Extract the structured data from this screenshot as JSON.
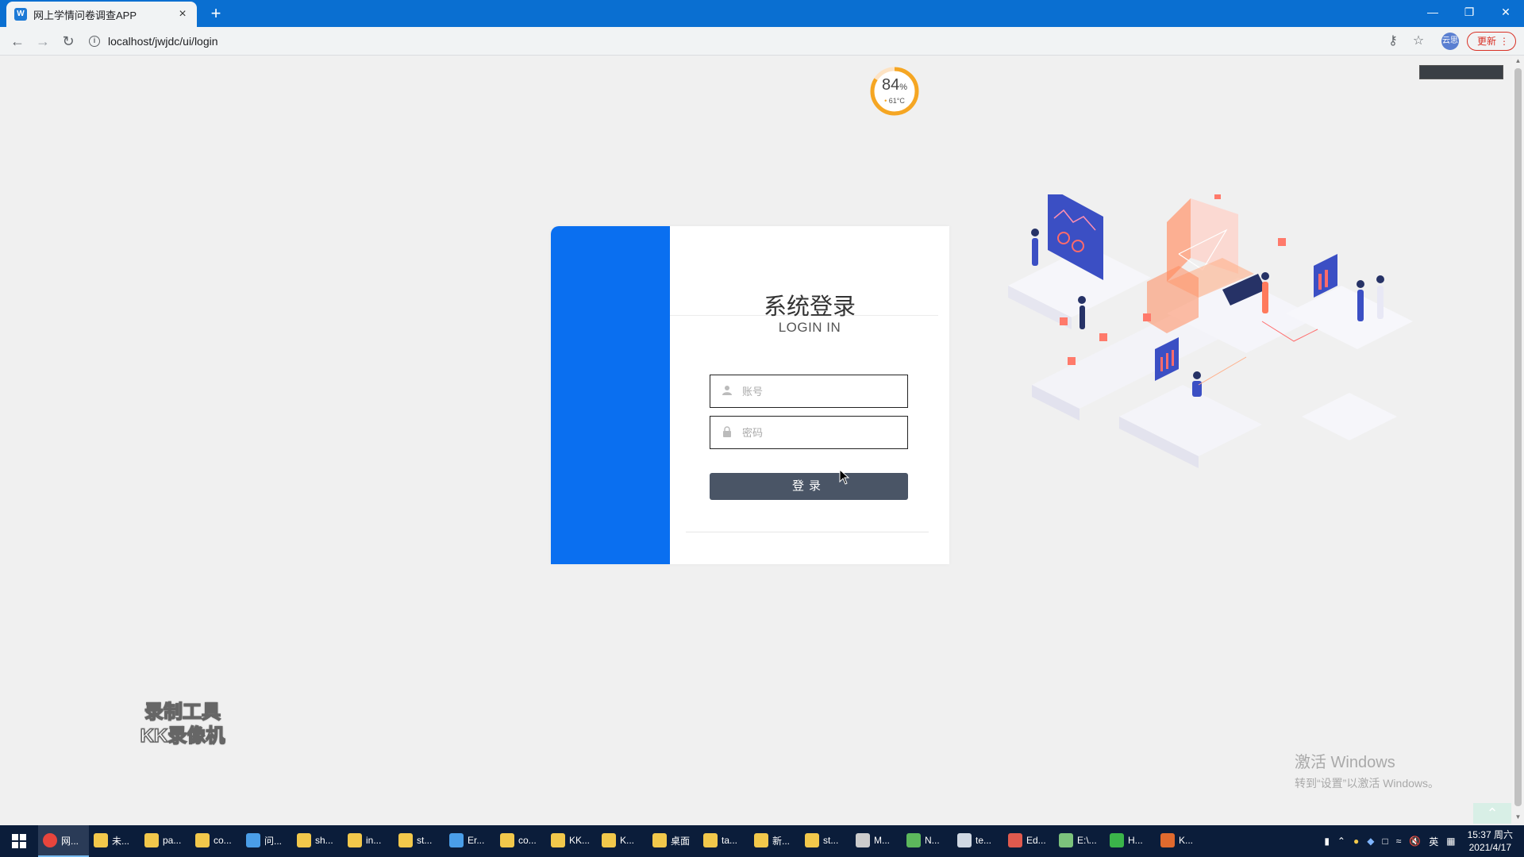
{
  "browser": {
    "tab_title": "网上学情问卷调查APP",
    "tab_close": "×",
    "new_tab": "+",
    "url": "localhost/jwjdc/ui/login",
    "update_label": "更新",
    "profile_label": "云思"
  },
  "widget": {
    "percent": "84",
    "percent_sign": "%",
    "temperature": "61°C",
    "percent_value": 0.84
  },
  "login": {
    "title_cn": "系统登录",
    "title_en": "LOGIN IN",
    "username_placeholder": "账号",
    "password_placeholder": "密码",
    "login_button": "登录"
  },
  "watermarks": {
    "recorder_line1": "录制工具",
    "recorder_line2": "KK录像机",
    "activate_line1": "激活 Windows",
    "activate_line2": "转到“设置”以激活 Windows。"
  },
  "taskbar": {
    "items": [
      {
        "label": "网...",
        "icon": "chrome-icon",
        "color": "#e8453c",
        "active": true
      },
      {
        "label": "未...",
        "icon": "folder-icon",
        "color": "#f2c84b"
      },
      {
        "label": "pa...",
        "icon": "folder-icon",
        "color": "#f2c84b"
      },
      {
        "label": "co...",
        "icon": "folder-icon",
        "color": "#f2c84b"
      },
      {
        "label": "问...",
        "icon": "app-icon",
        "color": "#4a9ee8"
      },
      {
        "label": "sh...",
        "icon": "folder-icon",
        "color": "#f2c84b"
      },
      {
        "label": "in...",
        "icon": "folder-icon",
        "color": "#f2c84b"
      },
      {
        "label": "st...",
        "icon": "folder-icon",
        "color": "#f2c84b"
      },
      {
        "label": "Er...",
        "icon": "app-icon",
        "color": "#4a9ee8"
      },
      {
        "label": "co...",
        "icon": "folder-icon",
        "color": "#f2c84b"
      },
      {
        "label": "KK...",
        "icon": "folder-icon",
        "color": "#f2c84b"
      },
      {
        "label": "K...",
        "icon": "folder-icon",
        "color": "#f2c84b"
      },
      {
        "label": "桌面",
        "icon": "folder-icon",
        "color": "#f2c84b"
      },
      {
        "label": "ta...",
        "icon": "folder-icon",
        "color": "#f2c84b"
      },
      {
        "label": "新...",
        "icon": "folder-icon",
        "color": "#f2c84b"
      },
      {
        "label": "st...",
        "icon": "folder-icon",
        "color": "#f2c84b"
      },
      {
        "label": "M...",
        "icon": "pen-icon",
        "color": "#cccccc"
      },
      {
        "label": "N...",
        "icon": "app-icon",
        "color": "#5cb85c"
      },
      {
        "label": "te...",
        "icon": "app-icon",
        "color": "#cfd8e3"
      },
      {
        "label": "Ed...",
        "icon": "app-icon",
        "color": "#e05a4e"
      },
      {
        "label": "E:\\...",
        "icon": "app-icon",
        "color": "#7cc37c"
      },
      {
        "label": "H...",
        "icon": "app-icon",
        "color": "#3bb54a"
      },
      {
        "label": "K...",
        "icon": "app-icon",
        "color": "#e06a2e"
      }
    ],
    "tray_lang": "英",
    "time": "15:37 周六",
    "date": "2021/4/17"
  },
  "colors": {
    "card_accent": "#0a6ff0",
    "login_button": "#4a5566",
    "titlebar": "#0a6fd1"
  }
}
